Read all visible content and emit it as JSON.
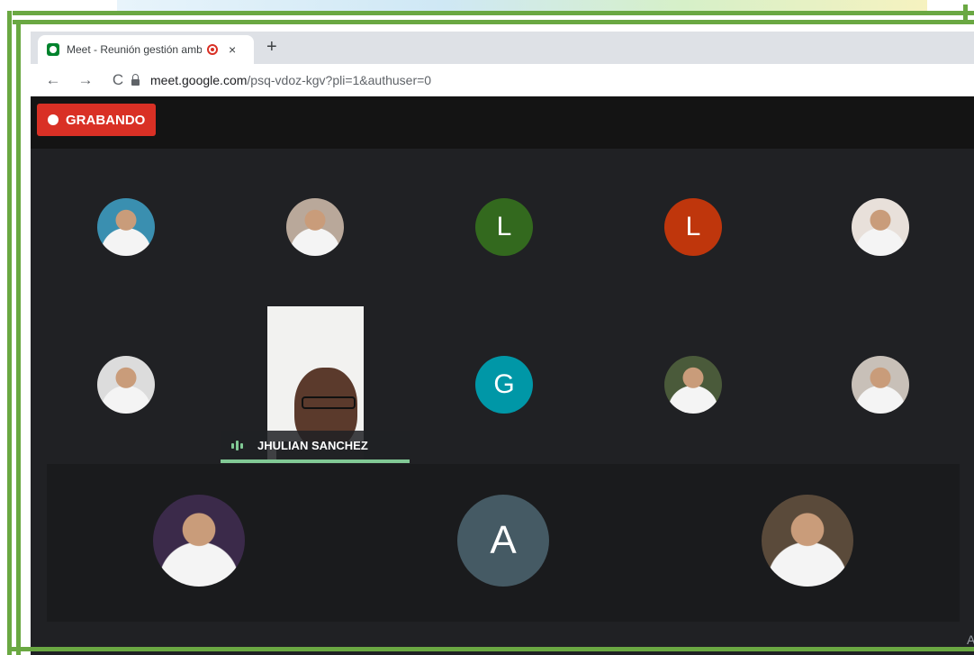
{
  "browser": {
    "tab_title": "Meet - Reunión gestión amb",
    "new_tab_label": "+",
    "close_label": "×",
    "back_label": "←",
    "forward_label": "→",
    "reload_label": "C",
    "url_host": "meet.google.com",
    "url_path": "/psq-vdoz-kgv?pli=1&authuser=0"
  },
  "meet": {
    "recording_label": "GRABANDO",
    "active_speaker": "JHULIAN SANCHEZ",
    "corner_text": "A",
    "participants": [
      {
        "type": "photo",
        "label": "",
        "color": "#3a8fb0"
      },
      {
        "type": "photo",
        "label": "",
        "color": "#b9a89a"
      },
      {
        "type": "initial",
        "label": "L",
        "color": "#33691e"
      },
      {
        "type": "initial",
        "label": "L",
        "color": "#bf360c"
      },
      {
        "type": "photo",
        "label": "",
        "color": "#e8e0da"
      },
      {
        "type": "photo",
        "label": "",
        "color": "#dcdcdc"
      },
      {
        "type": "initial",
        "label": "G",
        "color": "#0097a7"
      },
      {
        "type": "photo",
        "label": "",
        "color": "#4a5a3a"
      },
      {
        "type": "photo",
        "label": "",
        "color": "#c8c0b8"
      },
      {
        "type": "photo",
        "label": "",
        "color": "#3b2a4a"
      },
      {
        "type": "initial",
        "label": "A",
        "color": "#455a64"
      },
      {
        "type": "photo",
        "label": "",
        "color": "#5a4a3a"
      }
    ]
  },
  "colors": {
    "frame_green": "#6aa842",
    "recording_red": "#d93025",
    "meet_background": "#202124",
    "speaking_green": "#81c995"
  }
}
